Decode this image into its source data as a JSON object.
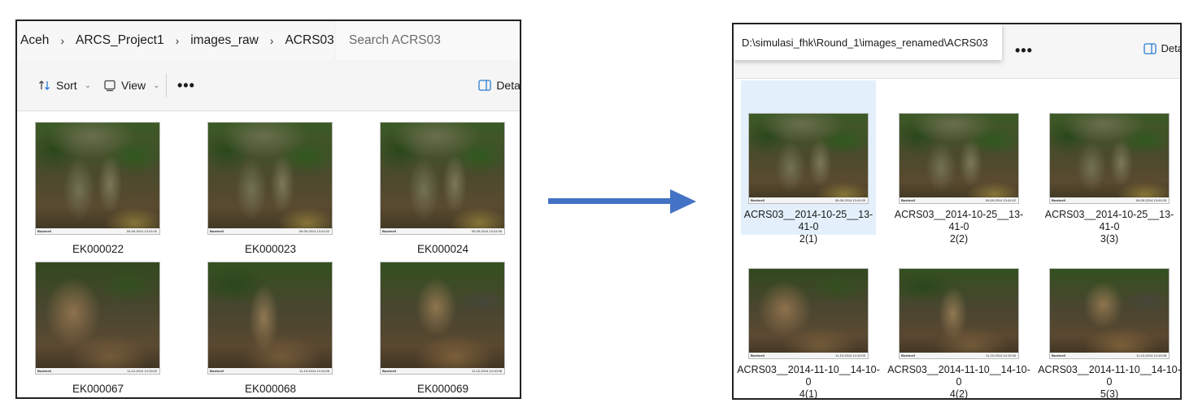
{
  "left_window": {
    "breadcrumb": [
      "Aceh",
      "ARCS_Project1",
      "images_raw",
      "ACRS03"
    ],
    "breadcrumb_separator": "›",
    "search_placeholder": "Search ACRS03",
    "toolbar": {
      "sort_label": "Sort",
      "view_label": "View",
      "more_label": "•••",
      "details_label": "Detai"
    },
    "files": [
      {
        "name": "EK000022",
        "stamp": "09-09-2014 13:41:00",
        "thumb": "monkey-grey"
      },
      {
        "name": "EK000023",
        "stamp": "09-09-2014 13:41:02",
        "thumb": "monkey-grey"
      },
      {
        "name": "EK000024",
        "stamp": "09-09-2014 13:41:05",
        "thumb": "monkey-grey"
      },
      {
        "name": "EK000067",
        "stamp": "11-10-2014 14:10:00",
        "thumb": "monkey-brown"
      },
      {
        "name": "EK000068",
        "stamp": "11-10-2014 14:10:06",
        "thumb": "monkey-brown2"
      },
      {
        "name": "EK000069",
        "stamp": "11-10-2014 14:10:08",
        "thumb": "monkey-brown3"
      }
    ],
    "camera_brand": "Bushnell"
  },
  "right_window": {
    "path": "D:\\simulasi_fhk\\Round_1\\images_renamed\\ACRS03",
    "more_label": "•••",
    "details_label": "Deta",
    "files": [
      {
        "line1": "ACRS03__2014-10-25__13-41-0",
        "line2": "2(1)",
        "selected": true
      },
      {
        "line1": "ACRS03__2014-10-25__13-41-0",
        "line2": "2(2)",
        "selected": false
      },
      {
        "line1": "ACRS03__2014-10-25__13-41-0",
        "line2": "3(3)",
        "selected": false
      },
      {
        "line1": "ACRS03__2014-11-10__14-10-0",
        "line2": "4(1)",
        "selected": false
      },
      {
        "line1": "ACRS03__2014-11-10__14-10-0",
        "line2": "4(2)",
        "selected": false
      },
      {
        "line1": "ACRS03__2014-11-10__14-10-0",
        "line2": "5(3)",
        "selected": false
      }
    ]
  },
  "colors": {
    "arrow": "#4472c4",
    "selection": "#e3f0fc",
    "details_icon": "#2b7cd3"
  }
}
